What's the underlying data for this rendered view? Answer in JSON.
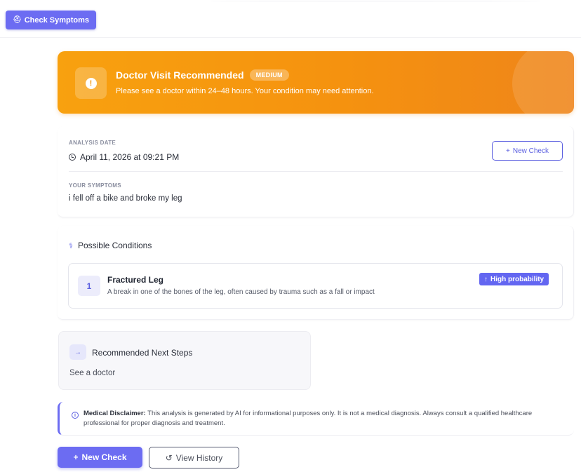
{
  "top_button": {
    "icon": "stethoscope-icon",
    "label": "Check Symptoms"
  },
  "banner": {
    "icon": "alert-icon",
    "title": "Doctor Visit Recommended",
    "severity": "MEDIUM",
    "message": "Please see a doctor within 24–48 hours. Your condition may need attention.",
    "color": "#f59e0b"
  },
  "analysis": {
    "date_label": "ANALYSIS DATE",
    "date_value": "April 11, 2026 at 09:21 PM",
    "new_check_label": "New Check",
    "symptoms_label": "YOUR SYMPTOMS",
    "symptoms_value": "i fell off a bike and broke my leg"
  },
  "conditions": {
    "title": "Possible Conditions",
    "items": [
      {
        "number": "1",
        "name": "Fractured Leg",
        "description": "A break in one of the bones of the leg, often caused by trauma such as a fall or impact",
        "probability": "High probability"
      }
    ]
  },
  "next_steps": {
    "title": "Recommended Next Steps",
    "text": "See a doctor"
  },
  "disclaimer": {
    "label": "Medical Disclaimer:",
    "text": " This analysis is generated by AI for informational purposes only. It is not a medical diagnosis. Always consult a qualified healthcare professional for proper diagnosis and treatment."
  },
  "actions": {
    "new_check": "New Check",
    "view_history": "View History"
  },
  "accent_color": "#6366f1"
}
